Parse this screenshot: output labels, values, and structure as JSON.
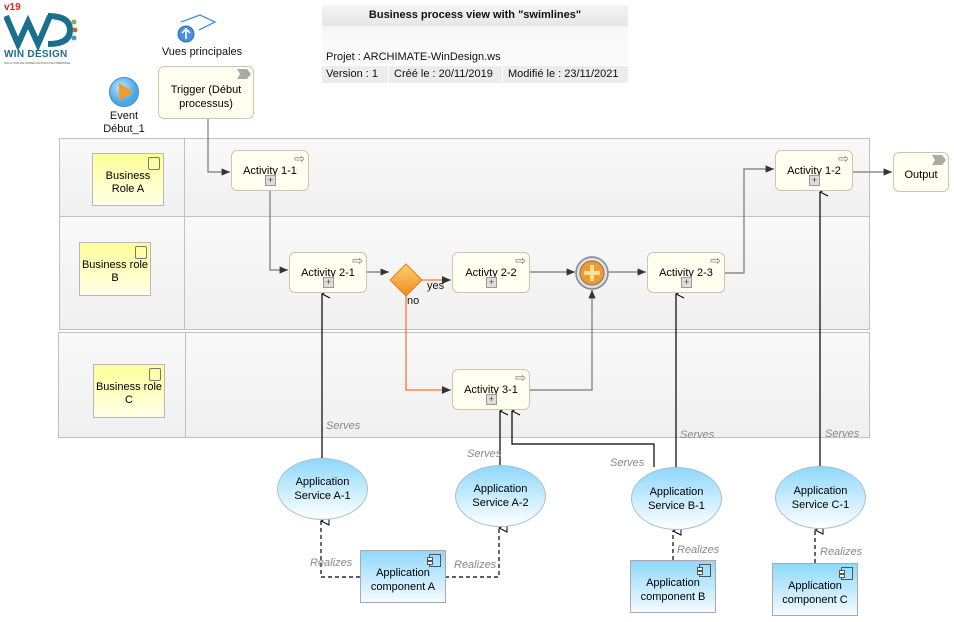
{
  "logo": {
    "version": "v19",
    "brand": "WIN DESIGN",
    "tagline": "SOLUTION DE MODÉLISATION D'ENTREPRISE"
  },
  "nav": {
    "main_views_label": "Vues principales"
  },
  "title_block": {
    "title": "Business process view with \"swimlines\"",
    "project": "Projet : ARCHIMATE-WinDesign.ws",
    "version": "Version : 1",
    "created": "Créé le : 20/11/2019",
    "modified": "Modifié le : 23/11/2021"
  },
  "event": {
    "label_line1": "Event",
    "label_line2": "Début_1"
  },
  "trigger": {
    "label": "Trigger (Début processus)"
  },
  "output": {
    "label": "Output"
  },
  "lanes": [
    {
      "role": "Business Role A"
    },
    {
      "role": "Business role B"
    },
    {
      "role": "Business role C"
    }
  ],
  "activities": {
    "a11": "Activity 1-1",
    "a21": "Activity 2-1",
    "a22": "Activty 2-2",
    "a23": "Activity 2-3",
    "a12": "Activity 1-2",
    "a31": "Activity 3-1"
  },
  "gateway": {
    "yes": "yes",
    "no": "no",
    "color": "#f39a2a"
  },
  "services": {
    "a1": "Application Service A-1",
    "a2": "Application Service A-2",
    "b1": "Application Service B-1",
    "c1": "Application Service C-1"
  },
  "components": {
    "a": "Application component A",
    "b": "Application component B",
    "c": "Application component C"
  },
  "relations": {
    "serves": "Serves",
    "realizes": "Realizes"
  }
}
